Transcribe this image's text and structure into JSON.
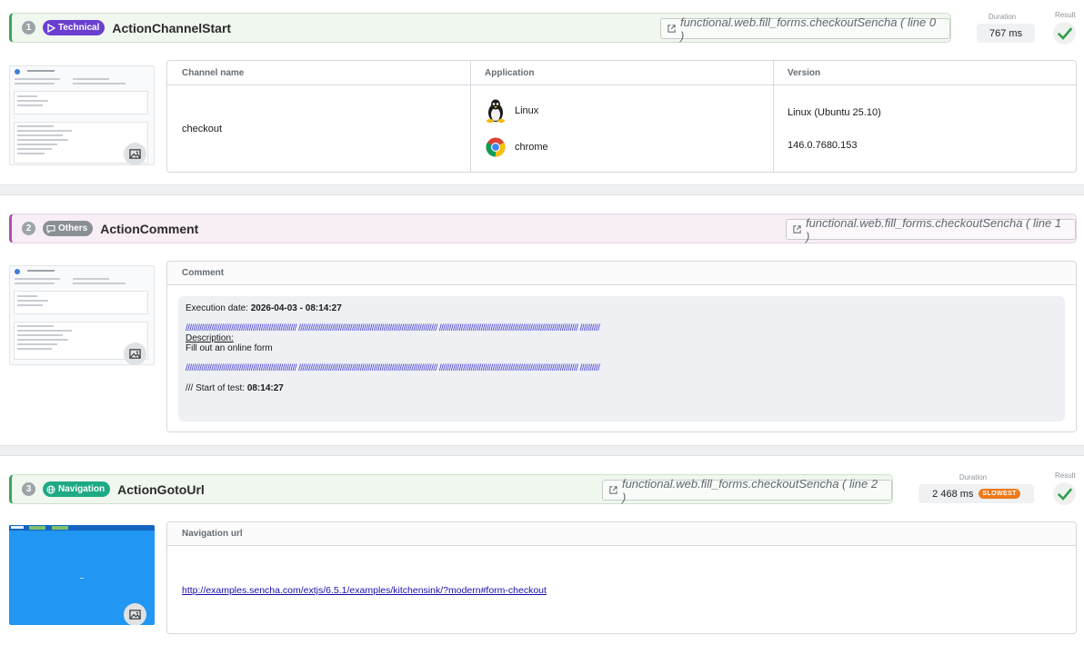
{
  "steps": [
    {
      "num": "1",
      "badge": "Technical",
      "name": "ActionChannelStart",
      "source": "functional.web.fill_forms.checkoutSencha ( line 0 )",
      "duration_label": "Duration",
      "duration": "767 ms",
      "result_label": "Result",
      "table": {
        "headers": [
          "Channel name",
          "Application",
          "Version"
        ],
        "channel": "checkout",
        "apps": [
          {
            "name": "Linux",
            "version": "Linux (Ubuntu 25.10)",
            "icon": "linux-penguin-icon"
          },
          {
            "name": "chrome",
            "version": "146.0.7680.153",
            "icon": "chrome-icon"
          }
        ]
      }
    },
    {
      "num": "2",
      "badge": "Others",
      "name": "ActionComment",
      "source": "functional.web.fill_forms.checkoutSencha ( line 1 )",
      "card_title": "Comment",
      "comment": {
        "exec_label": "Execution date: ",
        "exec_value": "2026-04-03 - 08:14:27",
        "slashes": "//////////////////////////////////////////////////////// ////////////////////////////////////////////////////////////////////// ////////////////////////////////////////////////////////////////////// //////////",
        "desc_label": "Description:",
        "desc_value": "Fill out an online form",
        "start_label": "/// Start of test: ",
        "start_value": "08:14:27"
      }
    },
    {
      "num": "3",
      "badge": "Navigation",
      "name": "ActionGotoUrl",
      "source": "functional.web.fill_forms.checkoutSencha ( line 2 )",
      "duration_label": "Duration",
      "duration": "2 468 ms",
      "slowest": "SLOWEST",
      "result_label": "Result",
      "card_title": "Navigation url",
      "url": "http://examples.sencha.com/extjs/6.5.1/examples/kitchensink/?modern#form-checkout"
    }
  ],
  "colors": {
    "technical": "#6a3fd0",
    "others": "#8a8f94",
    "navigation": "#1eaa85",
    "success": "#2e9e4f",
    "slowest": "#ee7a1d"
  }
}
